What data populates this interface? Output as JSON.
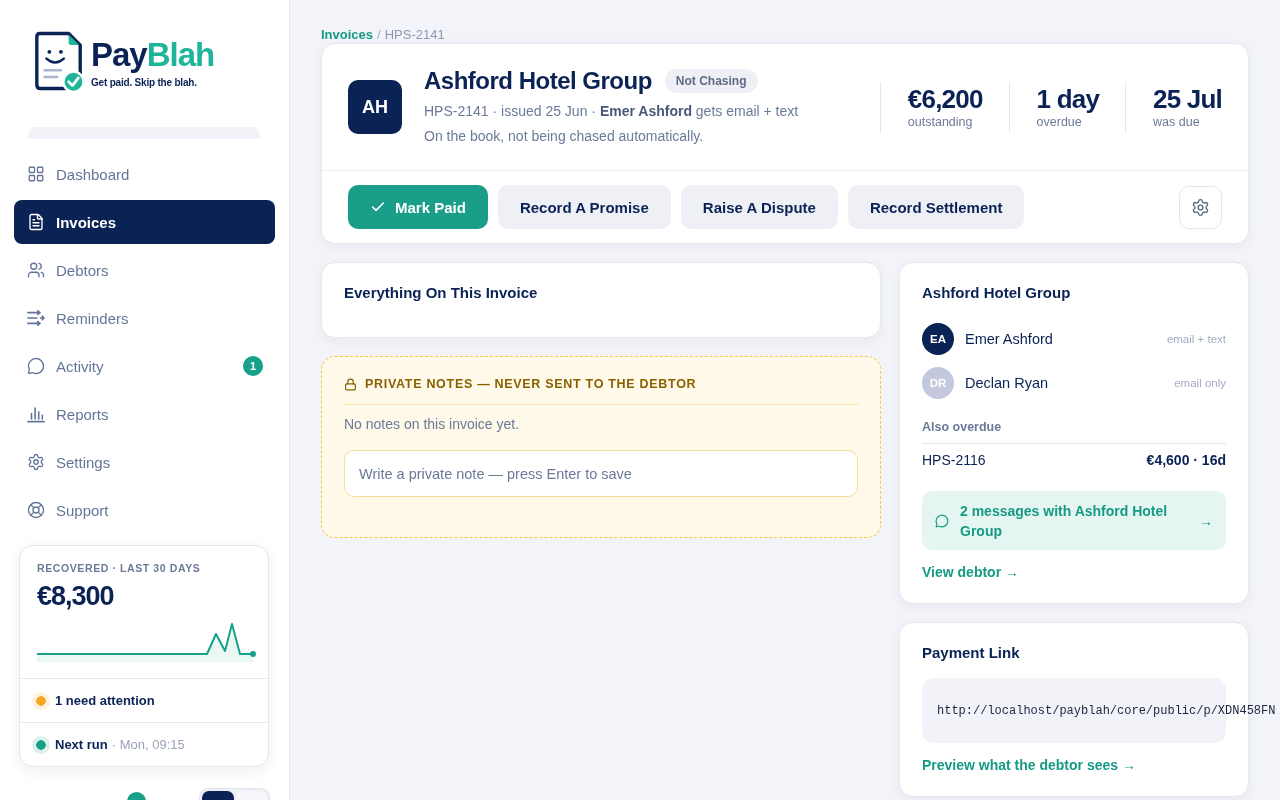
{
  "brand": {
    "name_dark": "Pay",
    "name_accent": "Blah",
    "tagline": "Get paid. Skip the blah."
  },
  "sidebar": {
    "nav": [
      {
        "label": "Dashboard",
        "selected": false
      },
      {
        "label": "Invoices",
        "selected": true
      },
      {
        "label": "Debtors",
        "selected": false
      },
      {
        "label": "Reminders",
        "selected": false
      },
      {
        "label": "Activity",
        "selected": false,
        "badge": "1"
      },
      {
        "label": "Reports",
        "selected": false
      },
      {
        "label": "Settings",
        "selected": false
      },
      {
        "label": "Support",
        "selected": false
      }
    ],
    "recovered": {
      "label": "RECOVERED · LAST 30 DAYS",
      "amount": "€8,300",
      "statuses": [
        {
          "title": "1 need attention",
          "color": "#f5a623"
        },
        {
          "title": "Next run",
          "detail": "· Mon, 09:15",
          "color": "#16a085"
        }
      ]
    },
    "toggle": {
      "segments": [
        {
          "selected": true
        },
        {
          "selected": false
        }
      ]
    }
  },
  "breadcrumb": {
    "parent": "Invoices",
    "separator": "/",
    "current": "HPS-2141"
  },
  "invoice": {
    "initials": "AH",
    "debtor": "Ashford Hotel Group",
    "status": "Not Chasing",
    "meta": "HPS-2141 · issued 25 Jun · **Emer Ashford** gets email + text",
    "note": "On the book, not being chased automatically.",
    "stats": [
      {
        "value": "€6,200",
        "label": "outstanding"
      },
      {
        "value": "1 day",
        "label": "overdue"
      },
      {
        "value": "25 Jul",
        "label": "was due"
      }
    ],
    "actions": [
      {
        "label": "Mark Paid",
        "kind": "primary"
      },
      {
        "label": "Record A Promise",
        "kind": "secondary"
      },
      {
        "label": "Raise A Dispute",
        "kind": "secondary"
      },
      {
        "label": "Record Settlement",
        "kind": "secondary"
      }
    ]
  },
  "details_card": {
    "title": "Everything On This Invoice"
  },
  "private_notes": {
    "heading": "PRIVATE NOTES — NEVER SENT TO THE DEBTOR",
    "empty_text": "No notes on this invoice yet.",
    "placeholder": "Write a private note — press Enter to save"
  },
  "debtor_card": {
    "title": "Ashford Hotel Group",
    "contacts": [
      {
        "initials": "EA",
        "name": "Emer Ashford",
        "channel": "email + text",
        "color": "#0b2255"
      },
      {
        "initials": "DR",
        "name": "Declan Ryan",
        "channel": "email only",
        "color": "#c3c8dc"
      }
    ],
    "also_overdue": {
      "heading": "Also overdue",
      "rows": [
        {
          "invoice": "HPS-2116",
          "amount": "€4,600 · 16d"
        }
      ]
    },
    "messages": {
      "text": "2 messages with Ashford Hotel Group",
      "arrow": "→"
    },
    "view_link": "View debtor →"
  },
  "payment_link": {
    "title": "Payment Link",
    "url": "http://localhost/payblah/core/public/p/XDN458FN",
    "preview_link": "Preview what the debtor sees →"
  }
}
